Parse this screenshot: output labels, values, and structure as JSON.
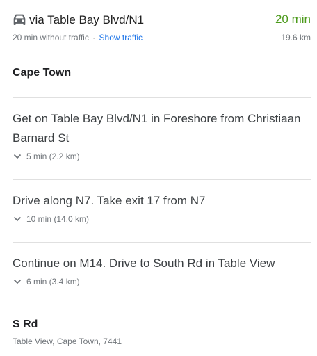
{
  "route": {
    "via_label": "via Table Bay Blvd/N1",
    "duration": "20 min",
    "distance": "19.6 km",
    "without_traffic": "20 min without traffic",
    "separator": "·",
    "show_traffic": "Show traffic",
    "icon": "car-icon",
    "duration_color": "#4c9a1b",
    "link_color": "#1a73e8"
  },
  "origin": {
    "name": "Cape Town"
  },
  "steps": [
    {
      "text": "Get on Table Bay Blvd/N1 in Foreshore from Christiaan Barnard St",
      "meta": "5 min (2.2 km)"
    },
    {
      "text": "Drive along N7. Take exit 17 from N7",
      "meta": "10 min (14.0 km)"
    },
    {
      "text": "Continue on M14. Drive to South Rd in Table View",
      "meta": "6 min (3.4 km)"
    }
  ],
  "destination": {
    "name": "S Rd",
    "address": "Table View, Cape Town, 7441"
  }
}
